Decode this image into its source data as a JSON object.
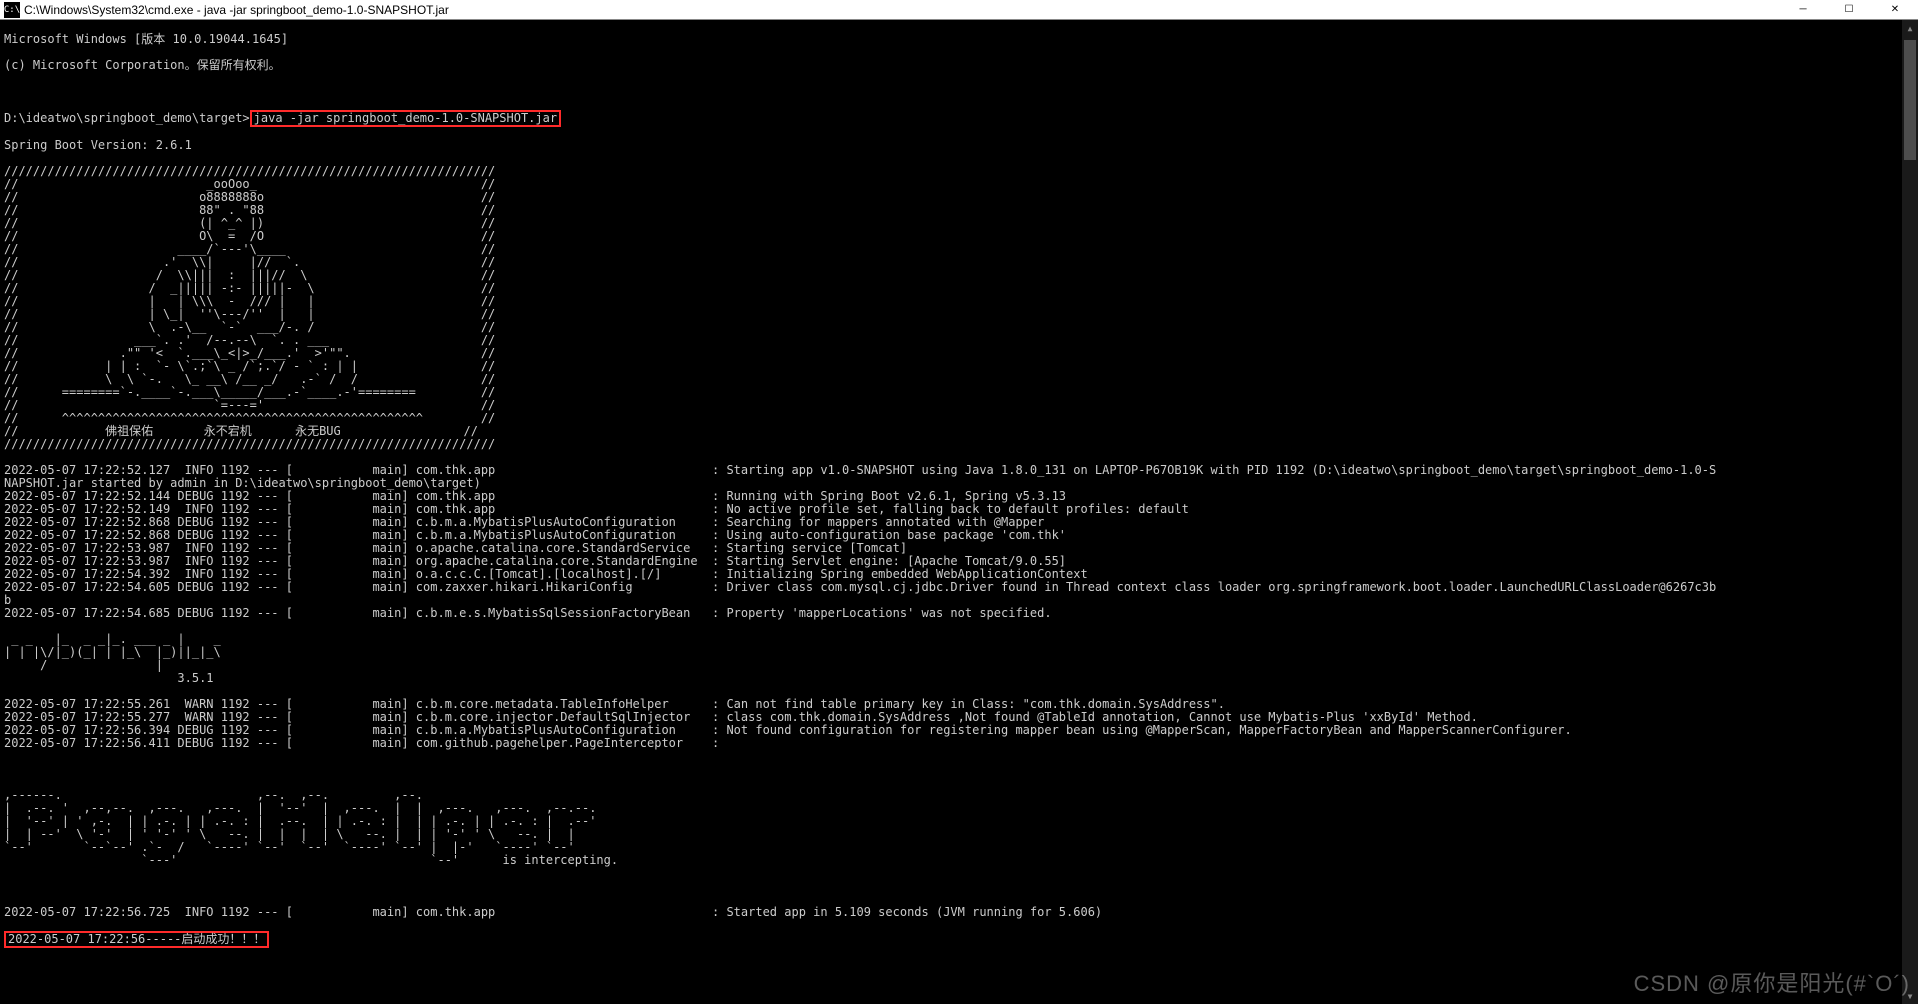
{
  "window": {
    "title": "C:\\Windows\\System32\\cmd.exe - java  -jar springboot_demo-1.0-SNAPSHOT.jar",
    "icon_label": "C:\\"
  },
  "header": {
    "line1": "Microsoft Windows [版本 10.0.19044.1645]",
    "line2": "(c) Microsoft Corporation。保留所有权利。"
  },
  "prompt": {
    "path": "D:\\ideatwo\\springboot_demo\\target>",
    "command": "java -jar springboot_demo-1.0-SNAPSHOT.jar"
  },
  "springboot_version_line": "Spring Boot Version: 2.6.1",
  "buddha_art": "////////////////////////////////////////////////////////////////////\n//                          _ooOoo_                               //\n//                         o8888888o                              //\n//                         88\" . \"88                              //\n//                         (| ^_^ |)                              //\n//                         O\\  =  /O                              //\n//                      ____/`---'\\____                           //\n//                    .'  \\\\|     |//  `.                         //\n//                   /  \\\\|||  :  |||//  \\                        //\n//                  /  _||||| -:- |||||-  \\                       //\n//                  |   | \\\\\\  -  /// |   |                       //\n//                  | \\_|  ''\\---/''  |   |                       //\n//                  \\  .-\\__  `-`  ___/-. /                       //\n//                ___`. .'  /--.--\\  `. . ___                     //\n//              .\"\" '<  `.___\\_<|>_/___.'  >'\"\".                  //\n//            | | :  `- \\`.;`\\ _ /`;.`/ - ` : | |                 //\n//            \\  \\ `-.   \\_ __\\ /__ _/   .-` /  /                 //\n//      ========`-.____`-.___\\_____/___.-`____.-'========         //\n//                           `=---='                              //\n//      ^^^^^^^^^^^^^^^^^^^^^^^^^^^^^^^^^^^^^^^^^^^^^^^^^^        //\n//            佛祖保佑       永不宕机      永无BUG                 //\n////////////////////////////////////////////////////////////////////",
  "mybatis_plus_art": " _ _   |_  _ _|_. ___ _ |    _\n| | |\\/|_)(_| | |_\\  |_)||_|_\\\n     /               |\n                        3.5.1",
  "pagehelper_art": ",------.                           ,--.  ,--.         ,--.\n|  .--. '  ,--,--.  ,---.   ,---.  |  '--'  |  ,---.  |  |  ,---.   ,---.  ,--.--.\n|  '--' | ' ,-.  | | .-. | | .-. : |  .--.  | | .-. : |  | | .-. | | .-. : |  .--'\n|  | --'  \\ '-'  | ' '-' ' \\   --. |  |  |  | \\   --. |  | | '-' ' \\   --. |  |\n`--'       `--`--' .`-  /   `----' `--'  `--'  `----' `--' |  |-'   `----' `--'\n                   `---'                                   `--'      is intercepting.",
  "logs": [
    "2022-05-07 17:22:52.127  INFO 1192 --- [           main] com.thk.app                              : Starting app v1.0-SNAPSHOT using Java 1.8.0_131 on LAPTOP-P67OB19K with PID 1192 (D:\\ideatwo\\springboot_demo\\target\\springboot_demo-1.0-S",
    "NAPSHOT.jar started by admin in D:\\ideatwo\\springboot_demo\\target)",
    "2022-05-07 17:22:52.144 DEBUG 1192 --- [           main] com.thk.app                              : Running with Spring Boot v2.6.1, Spring v5.3.13",
    "2022-05-07 17:22:52.149  INFO 1192 --- [           main] com.thk.app                              : No active profile set, falling back to default profiles: default",
    "2022-05-07 17:22:52.868 DEBUG 1192 --- [           main] c.b.m.a.MybatisPlusAutoConfiguration     : Searching for mappers annotated with @Mapper",
    "2022-05-07 17:22:52.868 DEBUG 1192 --- [           main] c.b.m.a.MybatisPlusAutoConfiguration     : Using auto-configuration base package 'com.thk'",
    "2022-05-07 17:22:53.987  INFO 1192 --- [           main] o.apache.catalina.core.StandardService   : Starting service [Tomcat]",
    "2022-05-07 17:22:53.987  INFO 1192 --- [           main] org.apache.catalina.core.StandardEngine  : Starting Servlet engine: [Apache Tomcat/9.0.55]",
    "2022-05-07 17:22:54.392  INFO 1192 --- [           main] o.a.c.c.C.[Tomcat].[localhost].[/]       : Initializing Spring embedded WebApplicationContext",
    "2022-05-07 17:22:54.605 DEBUG 1192 --- [           main] com.zaxxer.hikari.HikariConfig           : Driver class com.mysql.cj.jdbc.Driver found in Thread context class loader org.springframework.boot.loader.LaunchedURLClassLoader@6267c3b",
    "b",
    "2022-05-07 17:22:54.685 DEBUG 1192 --- [           main] c.b.m.e.s.MybatisSqlSessionFactoryBean   : Property 'mapperLocations' was not specified."
  ],
  "logs2": [
    "2022-05-07 17:22:55.261  WARN 1192 --- [           main] c.b.m.core.metadata.TableInfoHelper      : Can not find table primary key in Class: \"com.thk.domain.SysAddress\".",
    "2022-05-07 17:22:55.277  WARN 1192 --- [           main] c.b.m.core.injector.DefaultSqlInjector   : class com.thk.domain.SysAddress ,Not found @TableId annotation, Cannot use Mybatis-Plus 'xxById' Method.",
    "2022-05-07 17:22:56.394 DEBUG 1192 --- [           main] c.b.m.a.MybatisPlusAutoConfiguration     : Not found configuration for registering mapper bean using @MapperScan, MapperFactoryBean and MapperScannerConfigurer.",
    "2022-05-07 17:22:56.411 DEBUG 1192 --- [           main] com.github.pagehelper.PageInterceptor    :"
  ],
  "logs3": [
    "2022-05-07 17:22:56.725  INFO 1192 --- [           main] com.thk.app                              : Started app in 5.109 seconds (JVM running for 5.606)"
  ],
  "success_line": "2022-05-07 17:22:56-----启动成功！！！",
  "watermark": "CSDN @原你是阳光(#`O´)"
}
